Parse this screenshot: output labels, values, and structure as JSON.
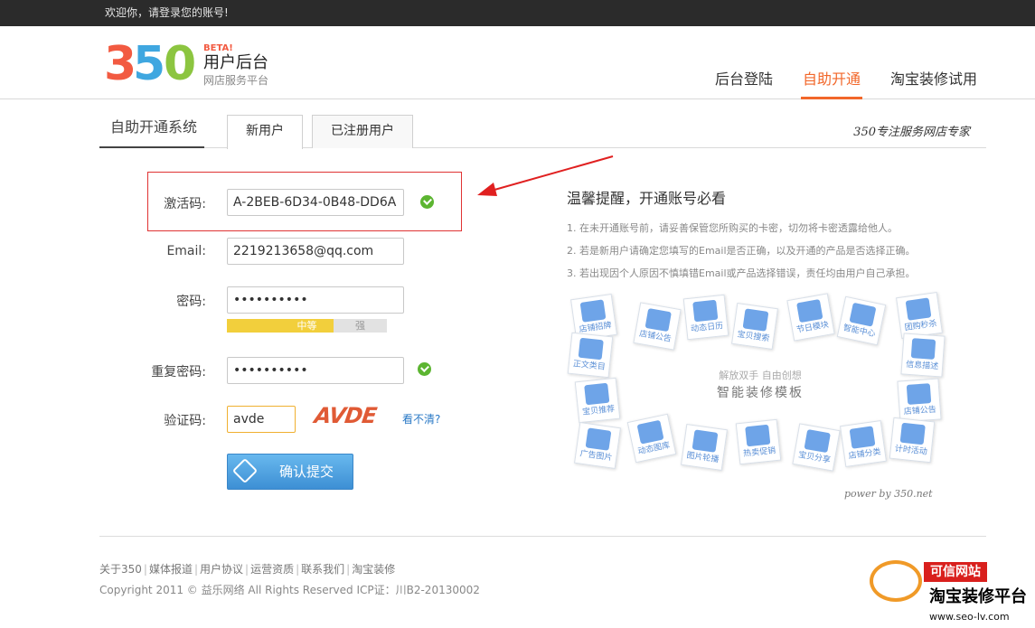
{
  "topbar": {
    "welcome": "欢迎你，请登录您的账号!"
  },
  "logo": {
    "beta": "BETA!",
    "name": "用户后台",
    "sub": "网店服务平台",
    "digits": [
      "3",
      "5",
      "0"
    ]
  },
  "nav": [
    {
      "label": "后台登陆",
      "active": false
    },
    {
      "label": "自助开通",
      "active": true
    },
    {
      "label": "淘宝装修试用",
      "active": false
    }
  ],
  "tabs": {
    "title": "自助开通系统",
    "new_user": "新用户",
    "registered": "已注册用户",
    "slogan": "350专注服务网店专家"
  },
  "form": {
    "activation_label": "激活码:",
    "activation_value": "A-2BEB-6D34-0B48-DD6A",
    "email_label": "Email:",
    "email_value": "2219213658@qq.com",
    "password_label": "密码:",
    "password_value": "••••••••••",
    "strength_mid": "中等",
    "strength_strong": "强",
    "repeat_label": "重复密码:",
    "repeat_value": "••••••••••",
    "captcha_label": "验证码:",
    "captcha_value": "avde",
    "captcha_image_text": "AVDE",
    "captcha_refresh": "看不清?",
    "submit": "确认提交"
  },
  "tips": {
    "title": "温馨提醒，开通账号必看",
    "lines": [
      "1. 在未开通账号前，请妥善保管您所购买的卡密，切勿将卡密透露给他人。",
      "2. 若是新用户请确定您填写的Email是否正确，以及开通的产品是否选择正确。",
      "3. 若出现因个人原因不慎填错Email或产品选择错误，责任均由用户自己承担。"
    ]
  },
  "templates": {
    "center_small": "解放双手 自由创想",
    "center_big": "智能装修模板",
    "power": "power by 350.net",
    "tiles": [
      "店铺招牌",
      "店铺公告",
      "动态日历",
      "宝贝搜索",
      "节日模块",
      "智能中心",
      "团购秒杀",
      "正文类目",
      "信息描述",
      "宝贝推荐",
      "店铺公告",
      "广告图片",
      "动态图库",
      "图片轮播",
      "热卖促销",
      "宝贝分享",
      "店铺分类",
      "计时活动"
    ]
  },
  "footer": {
    "links": [
      "关于350",
      "媒体报道",
      "用户协议",
      "运营资质",
      "联系我们",
      "淘宝装修"
    ],
    "copyright": "Copyright 2011 © 益乐网络  All Rights Reserved ICP证：川B2-20130002"
  },
  "badge": {
    "red": "可信网站",
    "big": "淘宝装修平台",
    "url": "www.seo-lv.com"
  },
  "colors": {
    "accent": "#f2672a",
    "error_box": "#e03333",
    "ok": "#5cb531",
    "button": "#3d8fd4"
  }
}
